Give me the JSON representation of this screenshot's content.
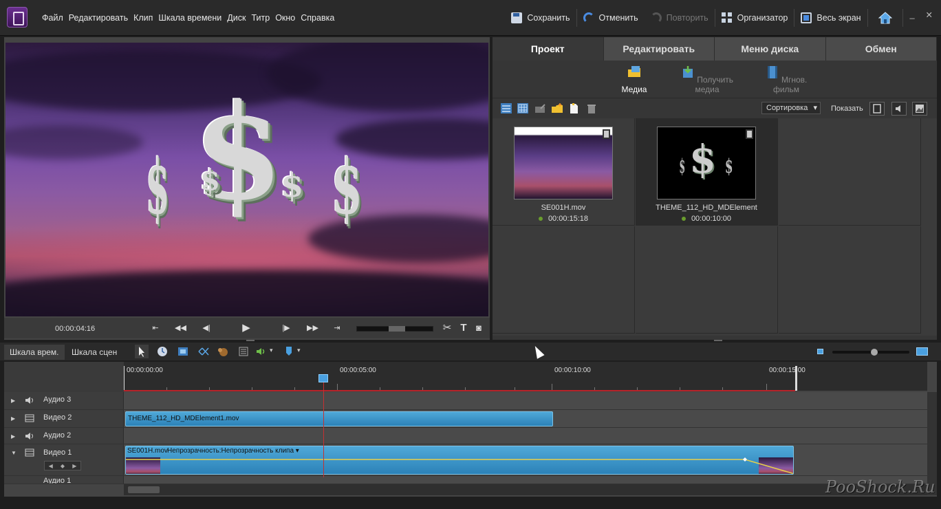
{
  "menu": [
    "Файл",
    "Редактировать",
    "Клип",
    "Шкала времени",
    "Диск",
    "Титр",
    "Окно",
    "Справка"
  ],
  "toolbar": {
    "save": "Сохранить",
    "undo": "Отменить",
    "redo": "Повторить",
    "organizer": "Организатор",
    "fullscreen": "Весь экран"
  },
  "monitor": {
    "timecode": "00:00:04:16"
  },
  "panel": {
    "tabs": [
      "Проект",
      "Редактировать",
      "Меню диска",
      "Обмен"
    ],
    "subtabs": [
      "Медиа",
      "Получить медиа",
      "Мгнов. фильм"
    ],
    "sort": "Сортировка",
    "show": "Показать",
    "clips": [
      {
        "name": "SE001H.mov",
        "duration": "00:00:15:18"
      },
      {
        "name": "THEME_112_HD_MDElement",
        "duration": "00:00:10:00"
      }
    ]
  },
  "timeline": {
    "tabs": [
      "Шкала врем.",
      "Шкала сцен"
    ],
    "ruler": [
      "00:00:00:00",
      "00:00:05:00",
      "00:00:10:00",
      "00:00:15:00"
    ],
    "tracks": [
      "Аудио 3",
      "Видео 2",
      "Аудио 2",
      "Видео 1",
      "Аудио 1"
    ],
    "clips": {
      "video2": "THEME_112_HD_MDElement1.mov",
      "video1": "SE001H.mov",
      "video1_effect": "Непрозрачность:Непрозрачность клипа"
    }
  },
  "watermark": "PooShock.Ru"
}
